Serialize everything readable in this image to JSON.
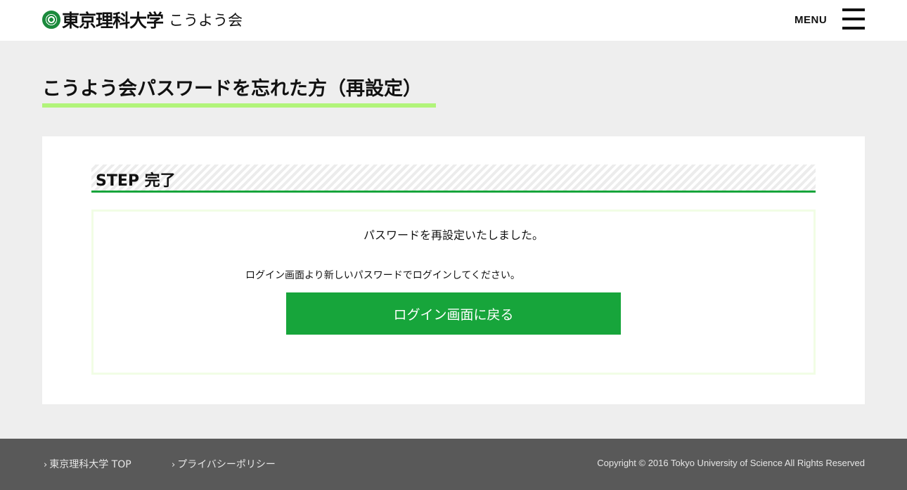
{
  "header": {
    "logo_university": "東京理科大学",
    "logo_subtitle": "こうよう会",
    "menu_label": "MENU"
  },
  "page": {
    "title": "こうよう会パスワードを忘れた方（再設定）"
  },
  "step": {
    "label": "STEP 完了"
  },
  "content": {
    "main_message": "パスワードを再設定いたしました。",
    "sub_message": "ログイン画面より新しいパスワードでログインしてください。",
    "login_button_label": "ログイン画面に戻る"
  },
  "footer": {
    "links": [
      {
        "label": "東京理科大学 TOP"
      },
      {
        "label": "プライバシーポリシー"
      }
    ],
    "copyright": "Copyright © 2016 Tokyo University of Science All Rights Reserved"
  },
  "colors": {
    "accent_green": "#17a53b",
    "title_underline": "#b1f47a",
    "footer_bg": "#595959",
    "page_bg": "#eeeeee"
  },
  "icons": [
    "logo-emblem-icon",
    "hamburger-menu-icon",
    "chevron-right-icon"
  ]
}
